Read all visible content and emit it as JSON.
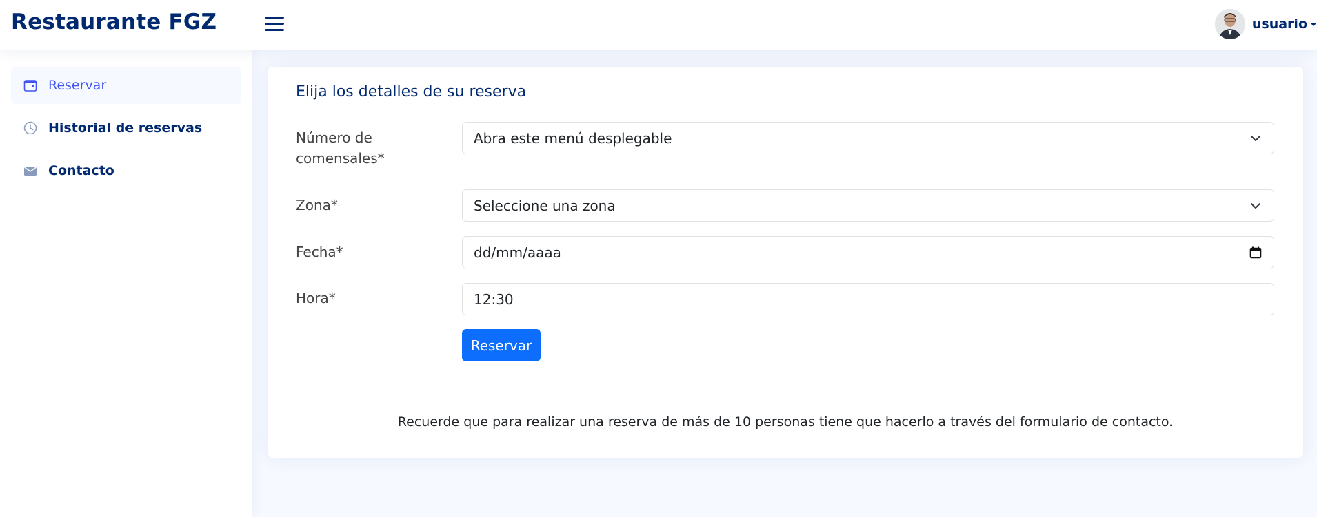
{
  "header": {
    "brand": "Restaurante FGZ",
    "menu_icon": "hamburger-icon",
    "user": {
      "name": "usuario",
      "avatar_icon": "avatar-photo"
    }
  },
  "sidebar": {
    "items": [
      {
        "label": "Reservar",
        "icon": "calendar-icon",
        "active": true
      },
      {
        "label": "Historial de reservas",
        "icon": "clock-icon",
        "active": false
      },
      {
        "label": "Contacto",
        "icon": "envelope-icon",
        "active": false
      }
    ]
  },
  "form": {
    "title": "Elija los detalles de su reserva",
    "fields": {
      "comensales": {
        "label_line1": "Número de",
        "label_line2": "comensales*",
        "value": "Abra este menú desplegable"
      },
      "zona": {
        "label": "Zona*",
        "value": "Seleccione una zona"
      },
      "fecha": {
        "label": "Fecha*",
        "value": "dd/mm/aaaa"
      },
      "hora": {
        "label": "Hora*",
        "value": "12:30"
      }
    },
    "submit_label": "Reservar",
    "note": "Recuerde que para realizar una reserva de más de 10 personas tiene que hacerlo a través del formulario de contacto."
  },
  "colors": {
    "brand": "#012970",
    "accent": "#4154f1",
    "primary_button": "#0d6efd",
    "background": "#f6f9ff"
  }
}
